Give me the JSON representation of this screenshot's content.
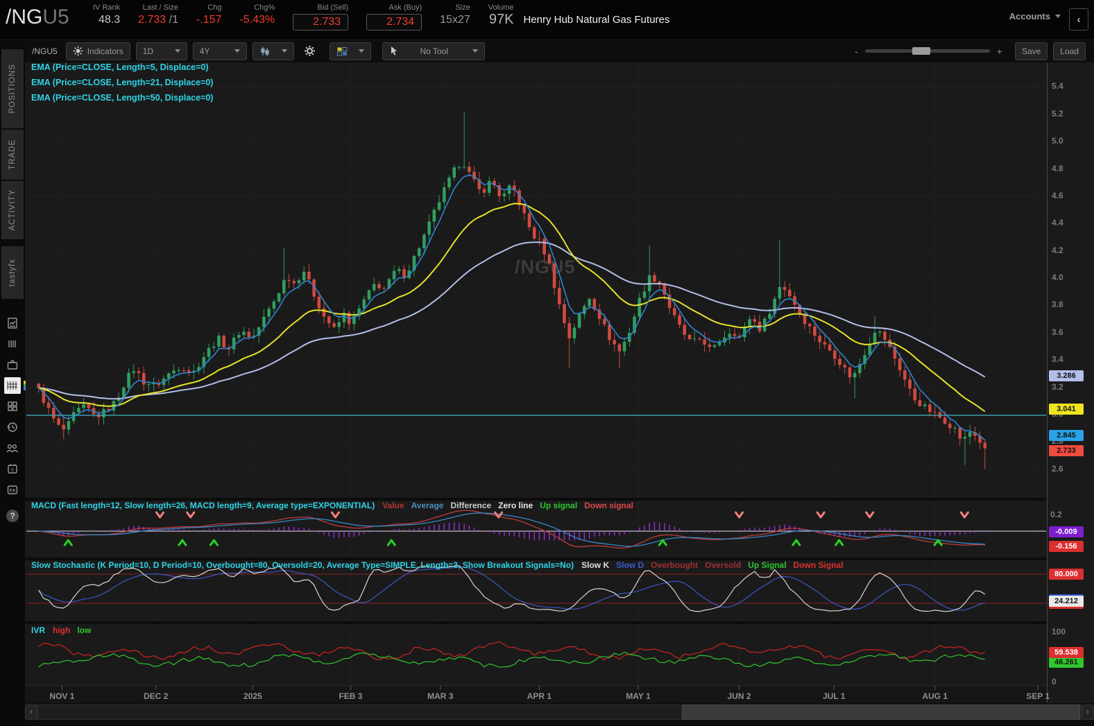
{
  "header": {
    "symbol": "/NG",
    "symbol_suffix": "U5",
    "fields": [
      {
        "label": "IV Rank",
        "value": "48.3"
      },
      {
        "label": "Last / Size",
        "value": "2.733",
        "suffix": " /1"
      },
      {
        "label": "Chg",
        "value": "-.157"
      },
      {
        "label": "Chg%",
        "value": "-5.43%"
      },
      {
        "label": "Bid (Sell)",
        "value": "2.733"
      },
      {
        "label": "Ask (Buy)",
        "value": "2.734"
      },
      {
        "label": "Size",
        "value": "15x27"
      },
      {
        "label": "Volume",
        "value": "97K"
      }
    ],
    "instrument_name": "Henry Hub Natural Gas Futures",
    "accounts_label": "Accounts"
  },
  "icons": {
    "collapse": "‹",
    "scroll_left": "‹",
    "scroll_right": "›"
  },
  "sidebar": {
    "tabs": [
      "POSITIONS",
      "TRADE",
      "ACTIVITY",
      "tastyfx"
    ]
  },
  "toolbar": {
    "symbol": "/NGU5",
    "indicators": "Indicators",
    "timeframe": "1D",
    "range": "4Y",
    "tool": "No Tool",
    "save": "Save",
    "load": "Load",
    "zoom_minus": "-",
    "zoom_plus": "+"
  },
  "chart_data": {
    "type": "candlestick",
    "symbol_watermark": "/NGU5",
    "studies": {
      "ema_labels": [
        "EMA (Price=CLOSE, Length=5, Displace=0)",
        "EMA (Price=CLOSE, Length=21, Displace=0)",
        "EMA (Price=CLOSE, Length=50, Displace=0)"
      ],
      "macd_label": "MACD (Fast length=12, Slow length=26, MACD length=9, Average type=EXPONENTIAL)",
      "macd_legend": [
        {
          "text": "Value",
          "color": "#b23535"
        },
        {
          "text": "Average",
          "color": "#4a8fbf"
        },
        {
          "text": "Difference",
          "color": "#cccccc"
        },
        {
          "text": "Zero line",
          "color": "#e8e8e8"
        },
        {
          "text": "Up signal",
          "color": "#2fc62f"
        },
        {
          "text": "Down signal",
          "color": "#e04848"
        }
      ],
      "stoch_label": "Slow Stochastic (K Period=10, D Period=10, Overbought=80, Oversold=20, Average Type=SIMPLE, Length=3, Show Breakout Signals=No)",
      "stoch_legend": [
        {
          "text": "Slow K",
          "color": "#e0e0e0"
        },
        {
          "text": "Slow D",
          "color": "#3a5fd0"
        },
        {
          "text": "Overbought",
          "color": "#a03030"
        },
        {
          "text": "Oversold",
          "color": "#a03030"
        },
        {
          "text": "Up Signal",
          "color": "#2fc62f"
        },
        {
          "text": "Down Signal",
          "color": "#e03030"
        }
      ],
      "ivr_label": "IVR",
      "ivr_legend": [
        {
          "text": "high",
          "color": "#e03030"
        },
        {
          "text": "low",
          "color": "#2fc62f"
        }
      ]
    },
    "colors": {
      "up": "#2f9e5f",
      "down": "#cf4a3f",
      "ema5": "#2f84d0",
      "ema21": "#e6e329",
      "ema50": "#b3bfe8",
      "support": "#3aa7b8",
      "macd_value": "#c23b3b",
      "macd_avg": "#3a86c8",
      "macd_hist": "#9b30d9",
      "stoch_k": "#d8d8d8",
      "stoch_d": "#3a58c8",
      "stoch_band": "#8b2323",
      "ivr_high": "#d42222",
      "ivr_low": "#2fc82f",
      "up_signal": "#22d622",
      "down_signal": "#f28080"
    },
    "x_ticks": [
      {
        "t": 0.035,
        "label": "NOV 1"
      },
      {
        "t": 0.127,
        "label": "DEC 2"
      },
      {
        "t": 0.222,
        "label": "2025"
      },
      {
        "t": 0.318,
        "label": "FEB 3"
      },
      {
        "t": 0.406,
        "label": "MAR 3"
      },
      {
        "t": 0.503,
        "label": "APR 1"
      },
      {
        "t": 0.6,
        "label": "MAY 1"
      },
      {
        "t": 0.699,
        "label": "JUN 2"
      },
      {
        "t": 0.792,
        "label": "JUL 1"
      },
      {
        "t": 0.891,
        "label": "AUG 1"
      },
      {
        "t": 0.992,
        "label": "SEP 1"
      }
    ],
    "y_ticks": [
      5.4,
      5.2,
      5.0,
      4.8,
      4.6,
      4.4,
      4.2,
      4.0,
      3.8,
      3.6,
      3.4,
      3.2,
      3.0,
      2.8,
      2.6
    ],
    "ylim": [
      2.39,
      5.57
    ],
    "support_line": 2.995,
    "price_keypoints": [
      [
        0.012,
        3.18
      ],
      [
        0.02,
        3.06
      ],
      [
        0.03,
        2.92
      ],
      [
        0.038,
        2.88
      ],
      [
        0.048,
        3.02
      ],
      [
        0.058,
        3.06
      ],
      [
        0.068,
        2.98
      ],
      [
        0.078,
        3.03
      ],
      [
        0.088,
        3.1
      ],
      [
        0.098,
        3.26
      ],
      [
        0.106,
        3.34
      ],
      [
        0.115,
        3.24
      ],
      [
        0.127,
        3.21
      ],
      [
        0.14,
        3.3
      ],
      [
        0.152,
        3.36
      ],
      [
        0.163,
        3.3
      ],
      [
        0.175,
        3.44
      ],
      [
        0.188,
        3.56
      ],
      [
        0.198,
        3.48
      ],
      [
        0.21,
        3.62
      ],
      [
        0.222,
        3.56
      ],
      [
        0.234,
        3.72
      ],
      [
        0.245,
        3.86
      ],
      [
        0.255,
        4.02
      ],
      [
        0.263,
        3.96
      ],
      [
        0.272,
        4.06
      ],
      [
        0.282,
        3.88
      ],
      [
        0.292,
        3.72
      ],
      [
        0.302,
        3.62
      ],
      [
        0.312,
        3.74
      ],
      [
        0.318,
        3.66
      ],
      [
        0.33,
        3.82
      ],
      [
        0.342,
        3.96
      ],
      [
        0.352,
        3.92
      ],
      [
        0.362,
        4.06
      ],
      [
        0.372,
        4.02
      ],
      [
        0.382,
        4.18
      ],
      [
        0.392,
        4.34
      ],
      [
        0.402,
        4.52
      ],
      [
        0.412,
        4.68
      ],
      [
        0.422,
        4.82
      ],
      [
        0.428,
        4.86
      ],
      [
        0.436,
        4.74
      ],
      [
        0.446,
        4.62
      ],
      [
        0.456,
        4.72
      ],
      [
        0.466,
        4.58
      ],
      [
        0.476,
        4.68
      ],
      [
        0.486,
        4.5
      ],
      [
        0.496,
        4.32
      ],
      [
        0.504,
        4.26
      ],
      [
        0.512,
        4.12
      ],
      [
        0.522,
        3.82
      ],
      [
        0.532,
        3.56
      ],
      [
        0.542,
        3.72
      ],
      [
        0.552,
        3.86
      ],
      [
        0.562,
        3.72
      ],
      [
        0.572,
        3.56
      ],
      [
        0.582,
        3.46
      ],
      [
        0.592,
        3.62
      ],
      [
        0.602,
        3.86
      ],
      [
        0.612,
        4.02
      ],
      [
        0.622,
        3.96
      ],
      [
        0.632,
        3.76
      ],
      [
        0.642,
        3.62
      ],
      [
        0.652,
        3.52
      ],
      [
        0.662,
        3.56
      ],
      [
        0.672,
        3.46
      ],
      [
        0.682,
        3.56
      ],
      [
        0.692,
        3.62
      ],
      [
        0.7,
        3.56
      ],
      [
        0.71,
        3.72
      ],
      [
        0.72,
        3.62
      ],
      [
        0.73,
        3.78
      ],
      [
        0.74,
        3.96
      ],
      [
        0.75,
        3.86
      ],
      [
        0.76,
        3.72
      ],
      [
        0.77,
        3.62
      ],
      [
        0.78,
        3.52
      ],
      [
        0.79,
        3.46
      ],
      [
        0.8,
        3.36
      ],
      [
        0.81,
        3.26
      ],
      [
        0.82,
        3.42
      ],
      [
        0.832,
        3.62
      ],
      [
        0.84,
        3.58
      ],
      [
        0.85,
        3.44
      ],
      [
        0.86,
        3.28
      ],
      [
        0.87,
        3.12
      ],
      [
        0.88,
        3.06
      ],
      [
        0.891,
        3.0
      ],
      [
        0.9,
        2.96
      ],
      [
        0.91,
        2.9
      ],
      [
        0.918,
        2.8
      ],
      [
        0.926,
        2.88
      ],
      [
        0.934,
        2.82
      ],
      [
        0.94,
        2.733
      ]
    ],
    "wick_highs": [
      [
        0.428,
        5.22
      ],
      [
        0.255,
        4.22
      ],
      [
        0.612,
        4.24
      ],
      [
        0.74,
        4.28
      ],
      [
        0.832,
        3.72
      ]
    ],
    "wick_lows": [
      [
        0.035,
        2.82
      ],
      [
        0.532,
        3.34
      ],
      [
        0.582,
        3.34
      ],
      [
        0.81,
        3.12
      ],
      [
        0.918,
        2.63
      ],
      [
        0.94,
        2.6
      ]
    ],
    "signals": {
      "up_t": [
        0.041,
        0.153,
        0.184,
        0.358,
        0.624,
        0.755,
        0.797,
        0.894
      ],
      "down_t": [
        0.131,
        0.161,
        0.303,
        0.463,
        0.699,
        0.779,
        0.827,
        0.92
      ]
    },
    "price_badges": [
      {
        "value": "3.286",
        "bg": "#b3bfe8",
        "fg": "#101010"
      },
      {
        "value": "3.041",
        "bg": "#efe322",
        "fg": "#101010"
      },
      {
        "value": "2.845",
        "bg": "#2aa3e8",
        "fg": "#101010"
      },
      {
        "value": "2.733",
        "bg": "#ef4b3e",
        "fg": "#101010"
      }
    ],
    "macd_axis_tick": "0.2",
    "macd_badges": [
      {
        "value": "-0.009",
        "bg": "#7d1fd1",
        "fg": "#ffffff"
      },
      {
        "value": "-0.156",
        "bg": "#dc2f2f",
        "fg": "#ffffff"
      }
    ],
    "stoch_badges": [
      {
        "value": "80.000",
        "bg": "#dc2f2f",
        "fg": "#ffffff"
      },
      {
        "value": "24.212",
        "bg": "#e8e8e8",
        "fg": "#101010"
      }
    ],
    "stoch_hidden": [
      {
        "bg": "#2b50c8",
        "v": 27
      },
      {
        "bg": "#dc2f2f",
        "v": 20
      }
    ],
    "ivr_ticks": [
      "100",
      "0"
    ],
    "ivr_badges": [
      {
        "value": "59.538",
        "bg": "#dc2f2f",
        "fg": "#ffffff"
      },
      {
        "value": "46.261",
        "bg": "#2fc82f",
        "fg": "#101010"
      }
    ]
  }
}
